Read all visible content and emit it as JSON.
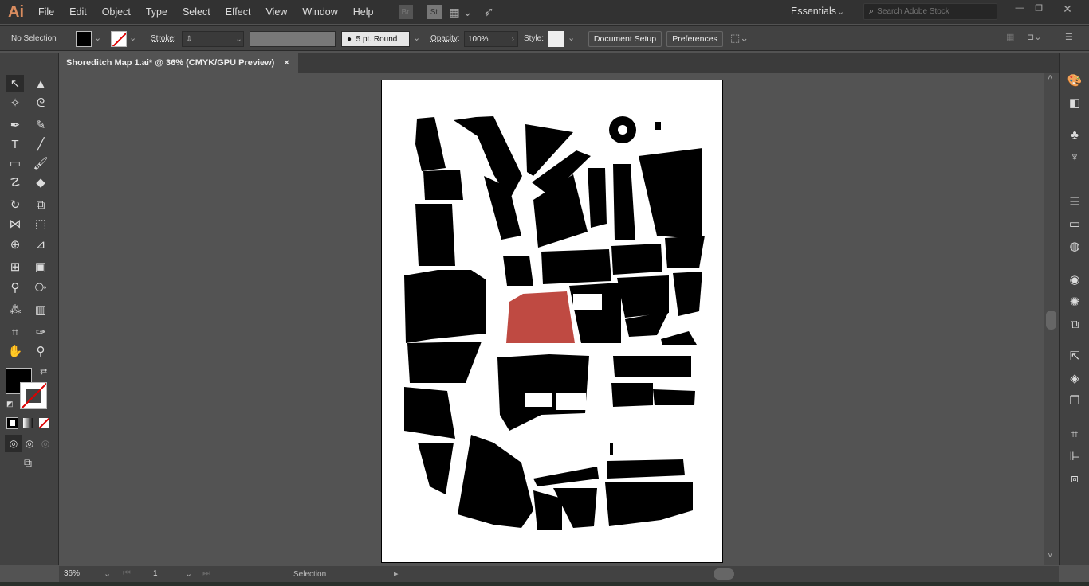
{
  "app": {
    "logo": "Ai",
    "menu": [
      "File",
      "Edit",
      "Object",
      "Type",
      "Select",
      "Effect",
      "View",
      "Window",
      "Help"
    ],
    "bridge": "Br",
    "stock": "St",
    "workspace": "Essentials",
    "search_placeholder": "Search Adobe Stock"
  },
  "control": {
    "selection": "No Selection",
    "stroke_label": "Stroke:",
    "brush": "5 pt. Round",
    "opacity_label": "Opacity:",
    "opacity": "100%",
    "style_label": "Style:",
    "document_setup": "Document Setup",
    "preferences": "Preferences",
    "fill_color": "#000000",
    "accent": "#c0483f"
  },
  "document": {
    "tab_title": "Shoreditch Map 1.ai* @ 36% (CMYK/GPU Preview)",
    "close": "×",
    "highlight_color": "#bf4a42"
  },
  "status": {
    "zoom": "36%",
    "artboard": "1",
    "tool": "Selection"
  }
}
